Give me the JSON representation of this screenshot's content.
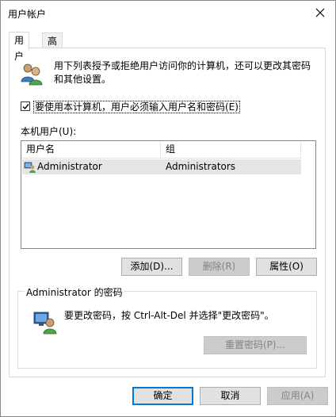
{
  "window": {
    "title": "用户帐户"
  },
  "tabs": [
    {
      "label": "用户",
      "active": true
    },
    {
      "label": "高级",
      "active": false
    }
  ],
  "intro": {
    "text": "用下列表授予或拒绝用户访问你的计算机，还可以更改其密码和其他设置。"
  },
  "require_login": {
    "label": "要使用本计算机，用户必须输入用户名和密码(E)",
    "checked": true
  },
  "users": {
    "label": "本机用户(U):",
    "columns": [
      "用户名",
      "组"
    ],
    "rows": [
      {
        "name": "Administrator",
        "group": "Administrators",
        "icon": "user-account-icon"
      }
    ]
  },
  "user_buttons": {
    "add": "添加(D)...",
    "remove": "删除(R)",
    "properties": "属性(O)"
  },
  "password_group": {
    "title": "Administrator 的密码",
    "text": "要更改密码，按 Ctrl-Alt-Del 并选择\"更改密码\"。",
    "reset_button": "重置密码(P)..."
  },
  "footer": {
    "ok": "确定",
    "cancel": "取消",
    "apply": "应用(A)"
  },
  "colors": {
    "accent": "#0078d7",
    "selection": "#e5e5e5",
    "disabled_text": "#838383"
  }
}
